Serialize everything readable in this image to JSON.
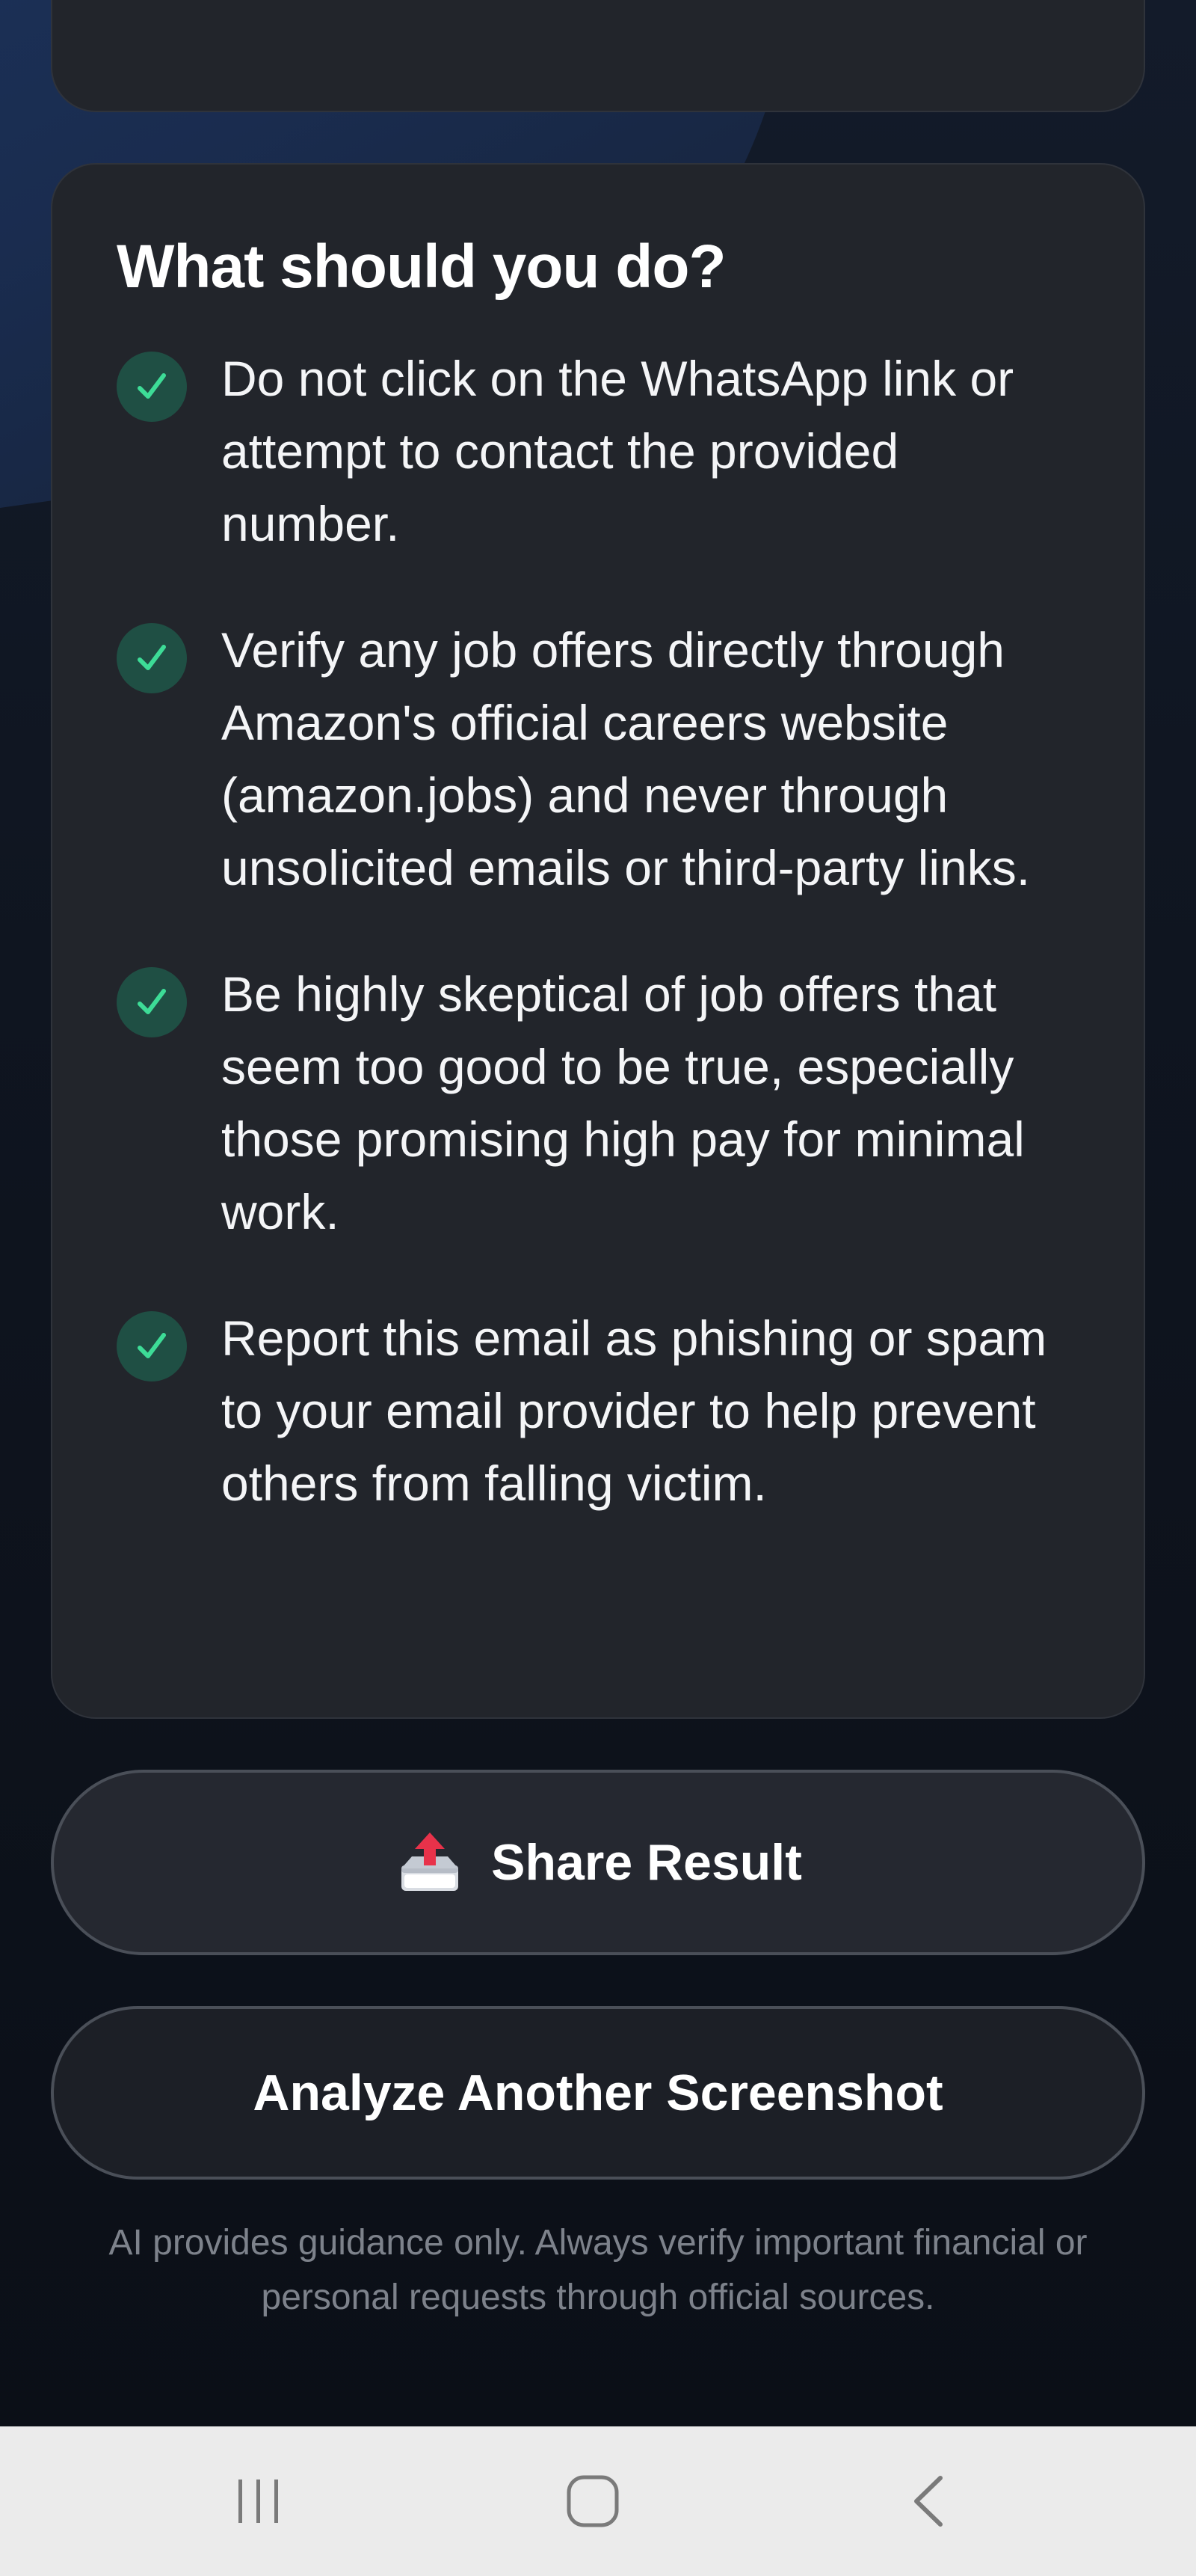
{
  "card": {
    "title": "What should you do?",
    "tips": [
      "Do not click on the WhatsApp link or attempt to contact the provided number.",
      "Verify any job offers directly through Amazon's official careers website (amazon.jobs) and never through unsolicited emails or third-party links.",
      "Be highly skeptical of job offers that seem too good to be true, especially those promising high pay for minimal work.",
      "Report this email as phishing or spam to your email provider to help prevent others from falling victim."
    ],
    "check_icon": "check-icon",
    "check_color": "#3ddc97",
    "check_bg": "#1f4f44"
  },
  "actions": {
    "share_label": "Share Result",
    "share_icon": "outbox-tray-icon",
    "analyze_label": "Analyze Another Screenshot"
  },
  "disclaimer": "AI provides guidance only. Always verify important financial or personal requests through official sources.",
  "navbar": {
    "recent_icon": "recent-apps-icon",
    "home_icon": "home-icon",
    "back_icon": "back-icon"
  },
  "colors": {
    "card_bg": "#22252b",
    "accent_blue": "#1e3763",
    "text": "#ffffff",
    "muted": "#7d828b"
  }
}
